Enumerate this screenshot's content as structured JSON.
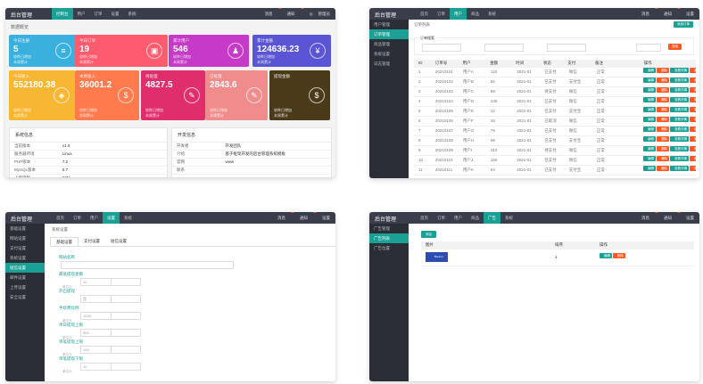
{
  "p1": {
    "logo": "后台管理",
    "nav": [
      "控制台",
      "用户",
      "订单",
      "设置",
      "系统"
    ],
    "right": [
      "消息",
      "通知",
      "◎",
      "管理员"
    ],
    "section": "数据概览",
    "cards": [
      {
        "title": "今日注册",
        "value": "5",
        "sub1": "较昨日增加",
        "sub2": "本周累计",
        "color": "#3ab0de",
        "icon": "≡"
      },
      {
        "title": "今日订单",
        "value": "19",
        "sub1": "较昨日增加",
        "sub2": "本周累计",
        "color": "#ff5b6e",
        "icon": "▣"
      },
      {
        "title": "累计用户",
        "value": "546",
        "sub1": "较昨日增加",
        "sub2": "本周累计",
        "color": "#c53ac7",
        "icon": "♟"
      },
      {
        "title": "累计金额",
        "value": "124636.23",
        "sub1": "较昨日增加",
        "sub2": "本周累计",
        "color": "#5a55d4",
        "icon": "¥"
      },
      {
        "title": "今日收入",
        "value": "552180.38",
        "sub1": "较昨日增加",
        "sub2": "本周累计",
        "color": "#f7b733",
        "icon": "◈"
      },
      {
        "title": "本周收入",
        "value": "36001.2",
        "sub1": "较昨日增加",
        "sub2": "本周累计",
        "color": "#ff7a4d",
        "icon": "$"
      },
      {
        "title": "待处理",
        "value": "4827.5",
        "sub1": "较昨日增加",
        "sub2": "本周累计",
        "color": "#e02e6d",
        "icon": "✎"
      },
      {
        "title": "已处理",
        "value": "2843.6",
        "sub1": "较昨日增加",
        "sub2": "本周累计",
        "color": "#f08c8c",
        "icon": "✎"
      },
      {
        "title": "提现金额",
        "value": "",
        "sub1": "较昨日增加",
        "sub2": "本周累计",
        "color": "#4a3a1a",
        "icon": "$"
      }
    ],
    "sys_title": "系统信息",
    "sys_rows": [
      [
        "当前版本",
        "v1.0"
      ],
      [
        "服务器环境",
        "Linux"
      ],
      [
        "PHP版本",
        "7.2"
      ],
      [
        "MySQL版本",
        "5.7"
      ],
      [
        "上传限制",
        "50M"
      ]
    ],
    "dev_title": "开发信息",
    "dev_rows": [
      [
        "开发者",
        "开发团队"
      ],
      [
        "介绍",
        "基于框架开发的后台管理系统模板"
      ],
      [
        "官网",
        "www"
      ],
      [
        "联系",
        ""
      ]
    ]
  },
  "p2": {
    "logo": "后台管理",
    "nav": [
      "首页",
      "订单",
      "用户",
      "商品",
      "系统"
    ],
    "right": [
      "消息",
      "通知",
      "设置"
    ],
    "sidebar": [
      "用户管理",
      "订单管理",
      "商品管理",
      "系统设置",
      "日志管理"
    ],
    "crumb": "订单列表",
    "add": "添加订单",
    "search_label": "订单搜索",
    "search_btn": "搜索",
    "cols": [
      "ID",
      "订单号",
      "用户",
      "金额",
      "时间",
      "状态",
      "支付",
      "备注",
      "操作"
    ],
    "rows": [
      [
        "1",
        "20210101",
        "用户A",
        "120",
        "2021-01",
        "已支付",
        "微信",
        "正常"
      ],
      [
        "2",
        "20210102",
        "用户B",
        "56",
        "2021-01",
        "已支付",
        "支付宝",
        "正常"
      ],
      [
        "3",
        "20210103",
        "用户C",
        "88",
        "2021-01",
        "待支付",
        "微信",
        "正常"
      ],
      [
        "4",
        "20210104",
        "用户D",
        "230",
        "2021-01",
        "已支付",
        "微信",
        "正常"
      ],
      [
        "5",
        "20210105",
        "用户E",
        "12",
        "2021-01",
        "已支付",
        "支付宝",
        "正常"
      ],
      [
        "6",
        "20210106",
        "用户F",
        "45",
        "2021-01",
        "已取消",
        "微信",
        "正常"
      ],
      [
        "7",
        "20210107",
        "用户G",
        "76",
        "2021-01",
        "已支付",
        "微信",
        "正常"
      ],
      [
        "8",
        "20210108",
        "用户H",
        "99",
        "2021-01",
        "已支付",
        "支付宝",
        "正常"
      ],
      [
        "9",
        "20210109",
        "用户I",
        "310",
        "2021-01",
        "待支付",
        "微信",
        "正常"
      ],
      [
        "10",
        "20210110",
        "用户J",
        "150",
        "2021-01",
        "已支付",
        "微信",
        "正常"
      ],
      [
        "11",
        "20210111",
        "用户K",
        "64",
        "2021-01",
        "已支付",
        "支付宝",
        "正常"
      ]
    ],
    "act": [
      "编辑",
      "删除",
      "查看详情",
      "更多"
    ]
  },
  "p3": {
    "logo": "后台管理",
    "nav": [
      "首页",
      "订单",
      "用户",
      "设置",
      "系统"
    ],
    "right": [
      "消息",
      "通知",
      "设置"
    ],
    "sidebar": [
      "基础设置",
      "网站设置",
      "支付设置",
      "系统设置",
      "短信设置",
      "邮件设置",
      "上传设置",
      "安全设置"
    ],
    "crumb": "系统设置",
    "tabs": [
      "基础设置",
      "支付设置",
      "短信设置"
    ],
    "fields": [
      {
        "label": "网站名称",
        "value": "",
        "hint": ""
      },
      {
        "label": "最低提现金额",
        "value": "10",
        "hint": "单位元"
      },
      {
        "label": "开启提现",
        "value": "是",
        "hint": ""
      },
      {
        "label": "手续费比例",
        "value": "1000",
        "hint": "单位分"
      },
      {
        "label": "单日提现上限",
        "value": "500",
        "hint": "单位元"
      },
      {
        "label": "单笔提现上限",
        "value": "100",
        "hint": "单位元"
      },
      {
        "label": "单笔提现下限",
        "value": "10",
        "hint": "单位元"
      }
    ]
  },
  "p4": {
    "logo": "后台管理",
    "nav": [
      "首页",
      "订单",
      "用户",
      "商品",
      "广告",
      "系统"
    ],
    "right": [
      "消息",
      "通知",
      "设置"
    ],
    "sidebar": [
      "广告管理",
      "广告列表",
      "广告位置"
    ],
    "add": "添加",
    "cols": [
      "图片",
      "排序",
      "操作"
    ],
    "row": {
      "img": "Banner",
      "order": "1",
      "edit": "编辑",
      "del": "删除"
    }
  }
}
